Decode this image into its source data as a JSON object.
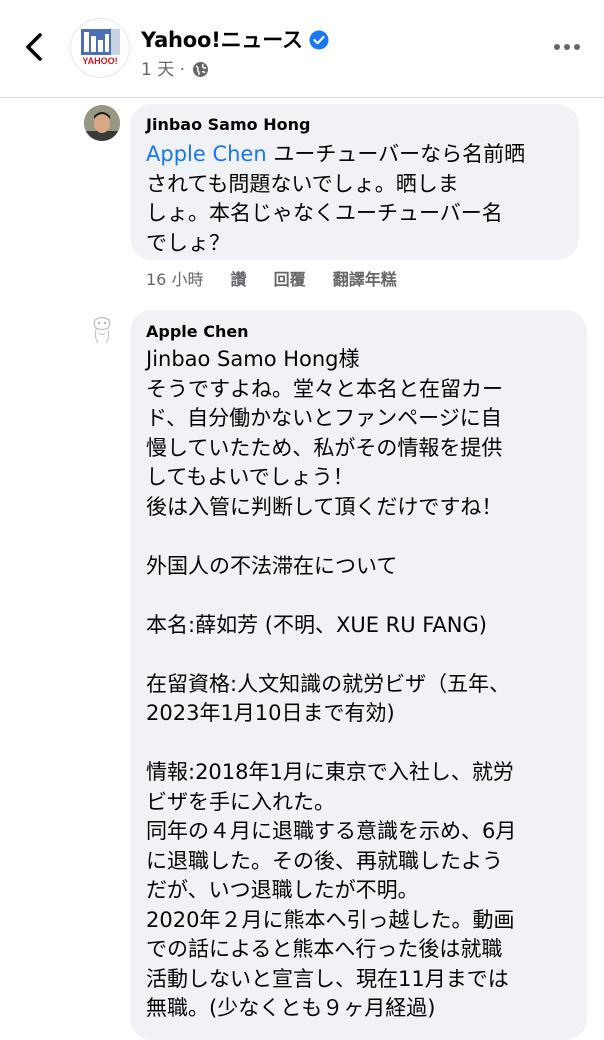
{
  "header": {
    "page_name": "Yahoo!ニュース",
    "logo_text": "YAHOO!",
    "time": "1 天",
    "separator": "·"
  },
  "comments": [
    {
      "author": "Jinbao Samo Hong",
      "mention": "Apple Chen",
      "text": " ユーチューバーなら名前晒\nされても問題ないでしょ。晒しま\nしょ。本名じゃなくユーチューバー名\nでしょ？",
      "time": "16 小時",
      "like_label": "讚",
      "reply_label": "回覆",
      "translate_label": "翻譯年糕"
    },
    {
      "author": "Apple Chen",
      "text": "Jinbao Samo Hong様\nそうですよね。堂々と本名と在留カー\nド、自分働かないとファンページに自\n慢していたため、私がその情報を提供\nしてもよいでしょう！\n後は入管に判断して頂くだけですね！\n\n外国人の不法滞在について\n\n本名:薛如芳 (不明、XUE RU FANG)\n\n在留資格:人文知識の就労ビザ（五年、\n2023年1月10日まで有効)\n\n情報:2018年1月に東京で入社し、就労\nビザを手に入れた。\n同年の４月に退職する意識を示め、6月\nに退職した。その後、再就職したよう\nだが、いつ退職したが不明。\n2020年２月に熊本へ引っ越した。動画\nでの話によると熊本へ行った後は就職\n活動しないと宣言し、現在11月までは\n無職。(少なくとも９ヶ月経過)"
    }
  ],
  "colors": {
    "accent": "#1877f2",
    "bubble": "#f0f2f5",
    "secondary_text": "#65676b"
  },
  "icons": [
    "back-arrow-icon",
    "verified-badge-icon",
    "globe-icon",
    "more-options-icon"
  ]
}
